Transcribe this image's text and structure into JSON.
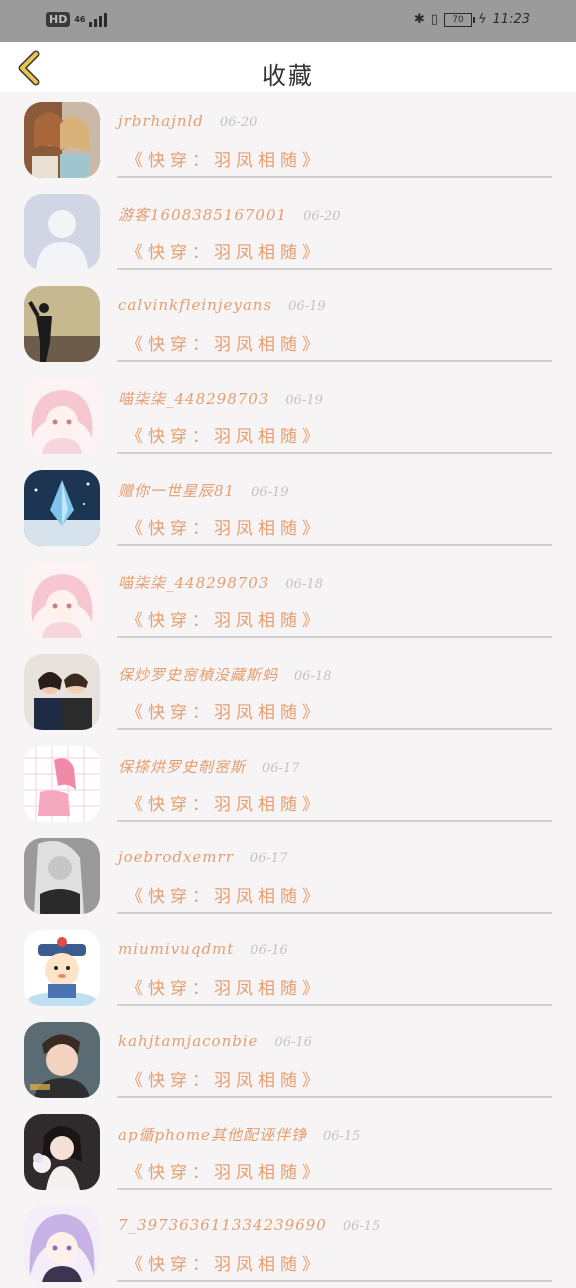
{
  "status_bar": {
    "left_badge": "HD",
    "network": "46",
    "battery": "70",
    "time": "11:23"
  },
  "header": {
    "title": "收藏",
    "back_icon": "chevron-left-icon"
  },
  "colors": {
    "accent": "#e59e6f",
    "date": "#c2c2c2",
    "back": "#e8c64b"
  },
  "favorites": [
    {
      "name": "jrbrhajnld",
      "date": "06-20",
      "book": "《快穿：羽凤相随》",
      "avatar": "photo-two-girls"
    },
    {
      "name": "游客1608385167001",
      "date": "06-20",
      "book": "《快穿：羽凤相随》",
      "avatar": "default-person"
    },
    {
      "name": "calvinkfleinjeyans",
      "date": "06-19",
      "book": "《快穿：羽凤相随》",
      "avatar": "photo-silhouette"
    },
    {
      "name": "喵柒柒_448298703",
      "date": "06-19",
      "book": "《快穿：羽凤相随》",
      "avatar": "anime-pink-girl"
    },
    {
      "name": "赠你一世星辰81",
      "date": "06-19",
      "book": "《快穿：羽凤相随》",
      "avatar": "blue-crystal"
    },
    {
      "name": "喵柒柒_448298703",
      "date": "06-18",
      "book": "《快穿：羽凤相随》",
      "avatar": "anime-pink-girl"
    },
    {
      "name": "保炒罗史宻楨没藏斯蚂",
      "date": "06-18",
      "book": "《快穿：羽凤相随》",
      "avatar": "photo-couple"
    },
    {
      "name": "保搽烘罗史剞宻斯",
      "date": "06-17",
      "book": "《快穿：羽凤相随》",
      "avatar": "pink-sketch"
    },
    {
      "name": "joebrodxemrr",
      "date": "06-17",
      "book": "《快穿：羽凤相随》",
      "avatar": "photo-bw-woman"
    },
    {
      "name": "miumivuqdmt",
      "date": "06-16",
      "book": "《快穿：羽凤相随》",
      "avatar": "cartoon-qing"
    },
    {
      "name": "kahjtamjaconbie",
      "date": "06-16",
      "book": "《快穿：羽凤相随》",
      "avatar": "photo-boy"
    },
    {
      "name": "ap循phome其他配诬伴铮",
      "date": "06-15",
      "book": "《快穿：羽凤相随》",
      "avatar": "photo-girl-flowers"
    },
    {
      "name": "7_397363611334239690",
      "date": "06-15",
      "book": "《快穿：羽凤相随》",
      "avatar": "anime-purple-girl"
    }
  ]
}
